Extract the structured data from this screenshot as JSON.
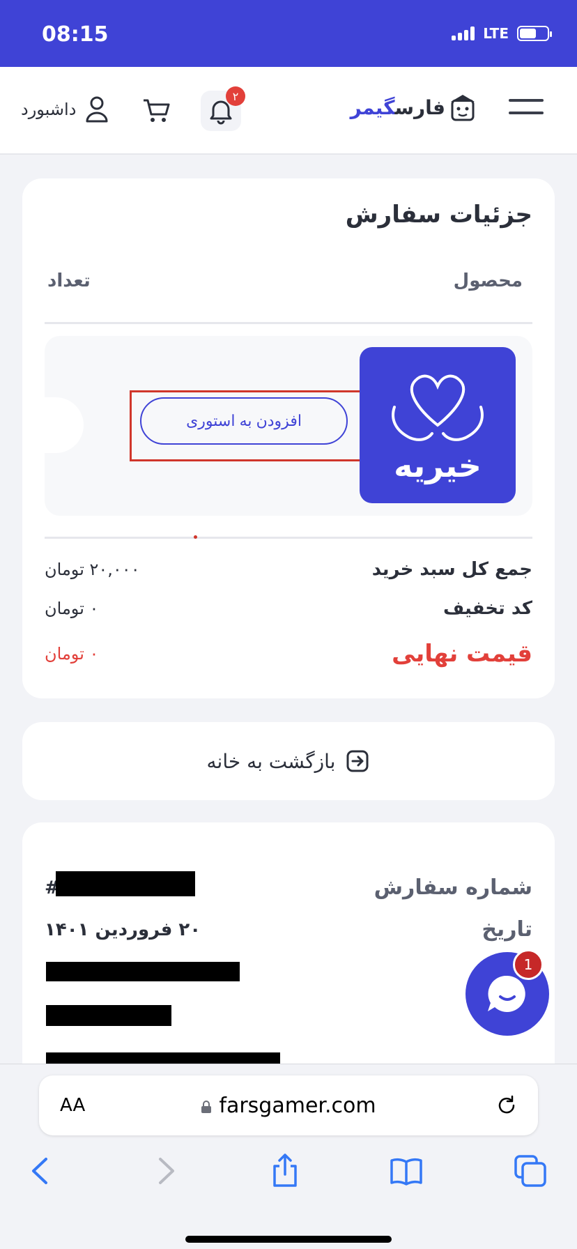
{
  "status": {
    "time": "08:15",
    "network": "LTE"
  },
  "header": {
    "logo_part1": "فارس",
    "logo_part2": "گیمر",
    "notifications_count": "۲",
    "dashboard_label": "داشبورد"
  },
  "order_details": {
    "title": "جزئیات سفارش",
    "col_product": "محصول",
    "col_quantity": "تعداد",
    "item": {
      "image_text": "خیریه",
      "story_button": "افزودن به استوری"
    },
    "summary": [
      {
        "label": "جمع کل سبد خرید",
        "value": "۲۰,۰۰۰ تومان"
      },
      {
        "label": "کد تخفیف",
        "value": "۰ تومان"
      }
    ],
    "final": {
      "label": "قیمت نهایی",
      "value": "۰ تومان"
    }
  },
  "back_home": {
    "label": "بازگشت به خانه"
  },
  "order_info": {
    "rows": [
      {
        "label": "شماره سفارش",
        "value": "#"
      },
      {
        "label": "تاریخ",
        "value": "۲۰ فروردین ۱۴۰۱"
      }
    ]
  },
  "chat": {
    "badge": "1"
  },
  "browser": {
    "aa": "AA",
    "url": "farsgamer.com"
  },
  "colors": {
    "brand": "#3f43d6",
    "danger": "#e2403a",
    "highlight": "#d0362b"
  }
}
